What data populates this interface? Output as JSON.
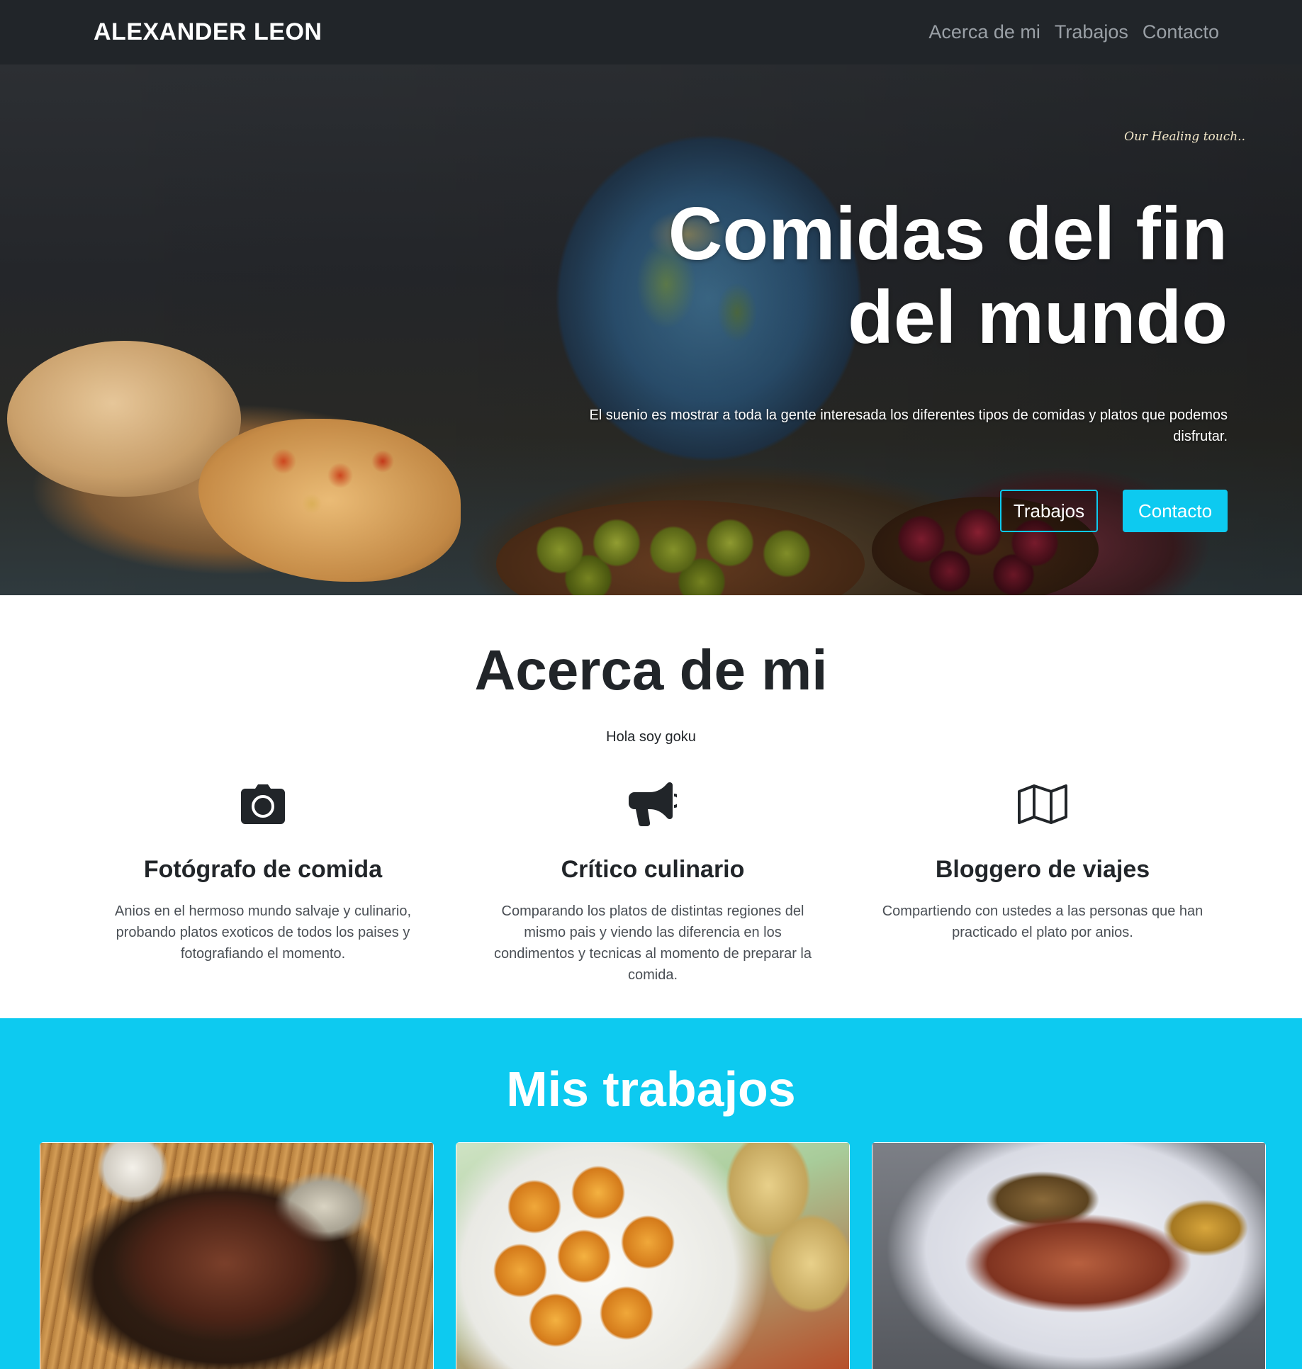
{
  "navbar": {
    "brand": "ALEXANDER LEON",
    "links": [
      "Acerca de mi",
      "Trabajos",
      "Contacto"
    ]
  },
  "hero": {
    "watermark": "Our Healing touch..",
    "title": "Comidas del fin del mundo",
    "text": "El suenio es mostrar a toda la gente interesada los diferentes tipos de comidas y platos que podemos disfrutar.",
    "buttons": {
      "primary": "Trabajos",
      "secondary": "Contacto"
    }
  },
  "about": {
    "title": "Acerca de mi",
    "lead": "Hola soy goku",
    "features": [
      {
        "icon": "camera-icon",
        "title": "Fotógrafo de comida",
        "text": "Anios en el hermoso mundo salvaje y culinario, probando platos exoticos de todos los paises y fotografiando el momento."
      },
      {
        "icon": "megaphone-icon",
        "title": "Crítico culinario",
        "text": "Comparando los platos de distintas regiones del mismo pais y viendo las diferencia en los condimentos y tecnicas al momento de preparar la comida."
      },
      {
        "icon": "map-icon",
        "title": "Bloggero de viajes",
        "text": "Compartiendo con ustedes a las personas que han practicado el plato por anios."
      }
    ]
  },
  "works": {
    "title": "Mis trabajos",
    "cards": [
      {
        "image": "roasted-lamb-and-baked-potato"
      },
      {
        "image": "potato-croquettes"
      },
      {
        "image": "grilled-salmon"
      }
    ]
  },
  "colors": {
    "navbar": "#212529",
    "accent": "#0dcaf0",
    "text": "#212529"
  }
}
